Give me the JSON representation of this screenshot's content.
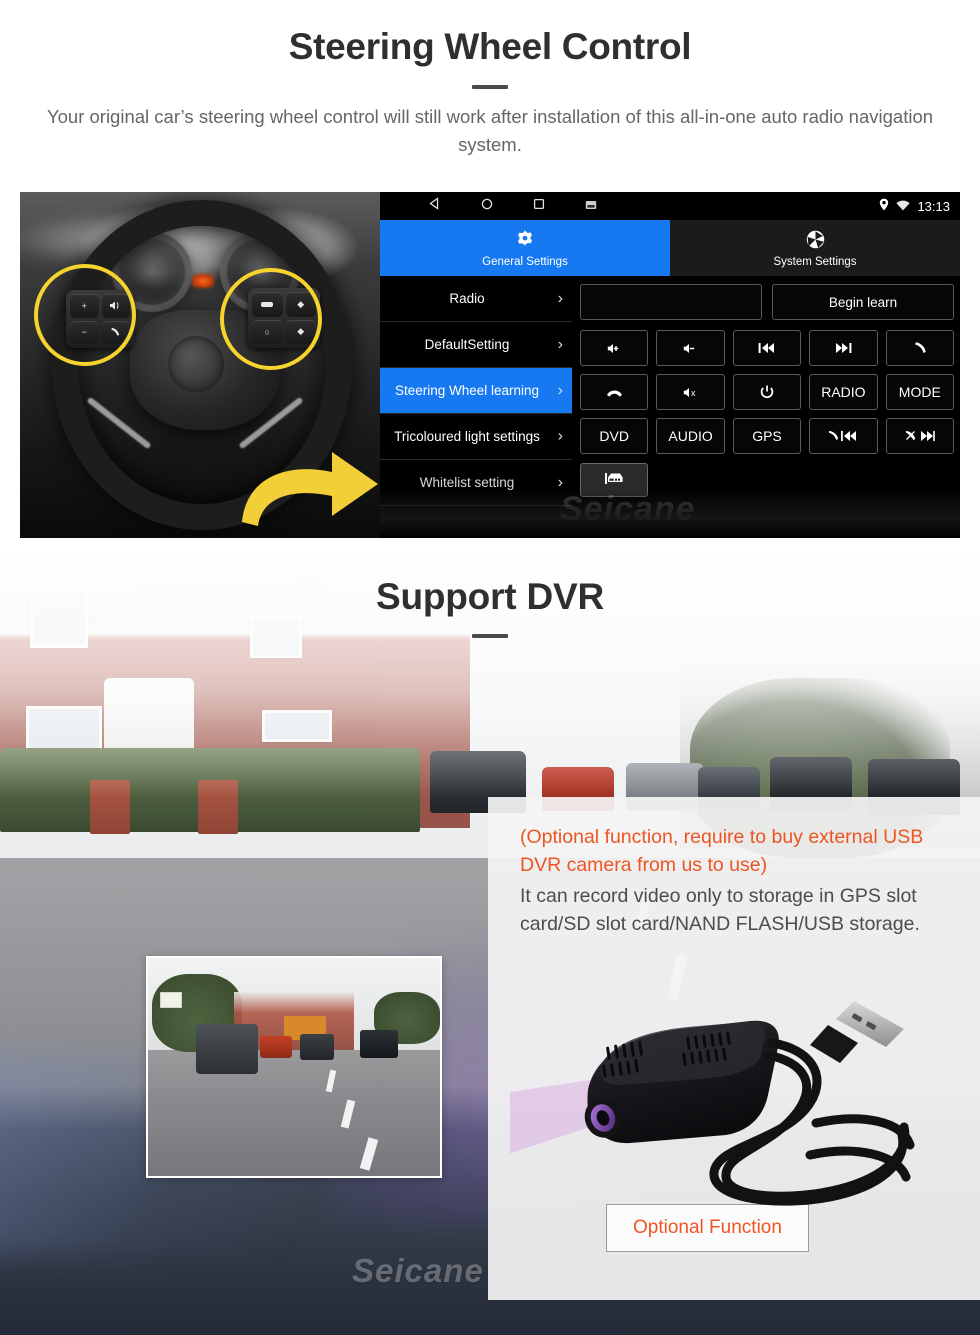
{
  "section1": {
    "title": "Steering Wheel Control",
    "subtitle": "Your original car’s steering wheel control will still work after installation of this all-in-one auto radio navigation system.",
    "head_unit": {
      "statusbar": {
        "back_icon": "back-triangle-icon",
        "home_icon": "home-circle-icon",
        "recents_icon": "recents-square-icon",
        "screenshot_icon": "screenshot-icon",
        "location_icon": "location-pin-icon",
        "wifi_icon": "wifi-icon",
        "time": "13:13"
      },
      "tabs": [
        {
          "label": "General Settings",
          "icon": "gear-icon",
          "active": true
        },
        {
          "label": "System Settings",
          "icon": "aperture-icon",
          "active": false
        }
      ],
      "menu_items": [
        {
          "label": "Radio",
          "selected": false
        },
        {
          "label": "DefaultSetting",
          "selected": false
        },
        {
          "label": "Steering Wheel learning",
          "selected": true
        },
        {
          "label": "Tricoloured light settings",
          "selected": false
        },
        {
          "label": "Whitelist setting",
          "selected": false
        }
      ],
      "learn_row": {
        "display_value": "",
        "begin_learn_label": "Begin learn"
      },
      "keys": [
        {
          "label": "",
          "icon": "volume-up-icon"
        },
        {
          "label": "",
          "icon": "volume-down-icon"
        },
        {
          "label": "",
          "icon": "previous-track-icon"
        },
        {
          "label": "",
          "icon": "next-track-icon"
        },
        {
          "label": "",
          "icon": "phone-answer-icon"
        },
        {
          "label": "",
          "icon": "phone-hangup-icon"
        },
        {
          "label": "",
          "icon": "volume-mute-icon"
        },
        {
          "label": "",
          "icon": "power-icon"
        },
        {
          "label": "RADIO",
          "icon": ""
        },
        {
          "label": "MODE",
          "icon": ""
        },
        {
          "label": "DVD",
          "icon": ""
        },
        {
          "label": "AUDIO",
          "icon": ""
        },
        {
          "label": "GPS",
          "icon": ""
        },
        {
          "label": "",
          "icon": "phone-previous-icon"
        },
        {
          "label": "",
          "icon": "phone-reject-next-icon"
        }
      ],
      "bottom_button": {
        "icon": "car-icon",
        "label": ""
      },
      "watermark": "Seicane"
    },
    "photo": {
      "alt": "steering wheel with highlighted control buttons and yellow arrow",
      "highlight_color": "#f6d32d",
      "arrow_color": "#f2cf37"
    }
  },
  "section2": {
    "title": "Support DVR",
    "info": {
      "red_text": "(Optional function, require to buy external USB DVR camera from us to use)",
      "grey_text": "It can record video only to storage in GPS slot card/SD slot card/NAND FLASH/USB storage.",
      "button_label": "Optional Function"
    },
    "inset_alt": "dashcam recorded street footage",
    "camera_alt": "black USB DVR dash camera with coiled cable",
    "watermark": "Seicane"
  },
  "colors": {
    "accent_blue": "#1779f2",
    "accent_orange": "#ee5522",
    "highlight_yellow": "#f6d32d",
    "heading_dark": "#2f2f2f",
    "body_grey": "#666666"
  }
}
